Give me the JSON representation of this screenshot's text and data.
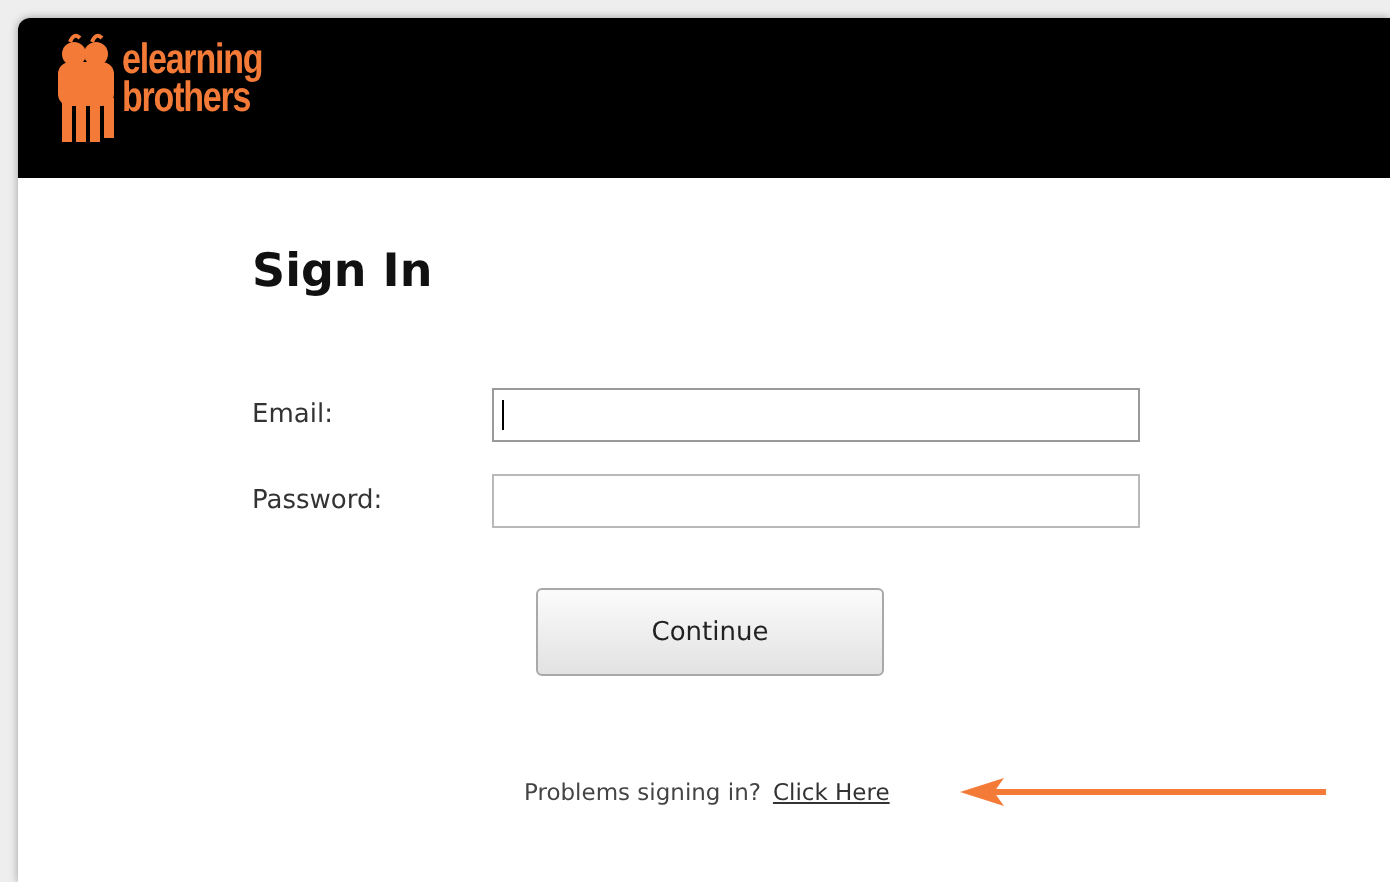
{
  "logo": {
    "line_1": "elearning",
    "line_2": "brothers"
  },
  "heading": "Sign In",
  "fields": [
    {
      "label": "Email:",
      "focused": true
    },
    {
      "label": "Password:",
      "focused": false
    }
  ],
  "button": "Continue",
  "help": {
    "text": "Problems signing in?",
    "link": "Click Here"
  }
}
